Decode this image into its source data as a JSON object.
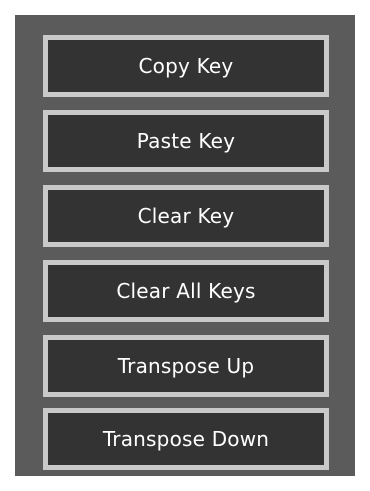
{
  "menu": {
    "items": [
      {
        "label": "Copy Key"
      },
      {
        "label": "Paste Key"
      },
      {
        "label": "Clear Key"
      },
      {
        "label": "Clear All Keys"
      },
      {
        "label": "Transpose Up"
      },
      {
        "label": "Transpose Down"
      }
    ]
  },
  "colors": {
    "panel_bg": "#5b5b5b",
    "button_bg": "#333333",
    "button_border": "#c9c9c9",
    "text": "#ffffff"
  }
}
